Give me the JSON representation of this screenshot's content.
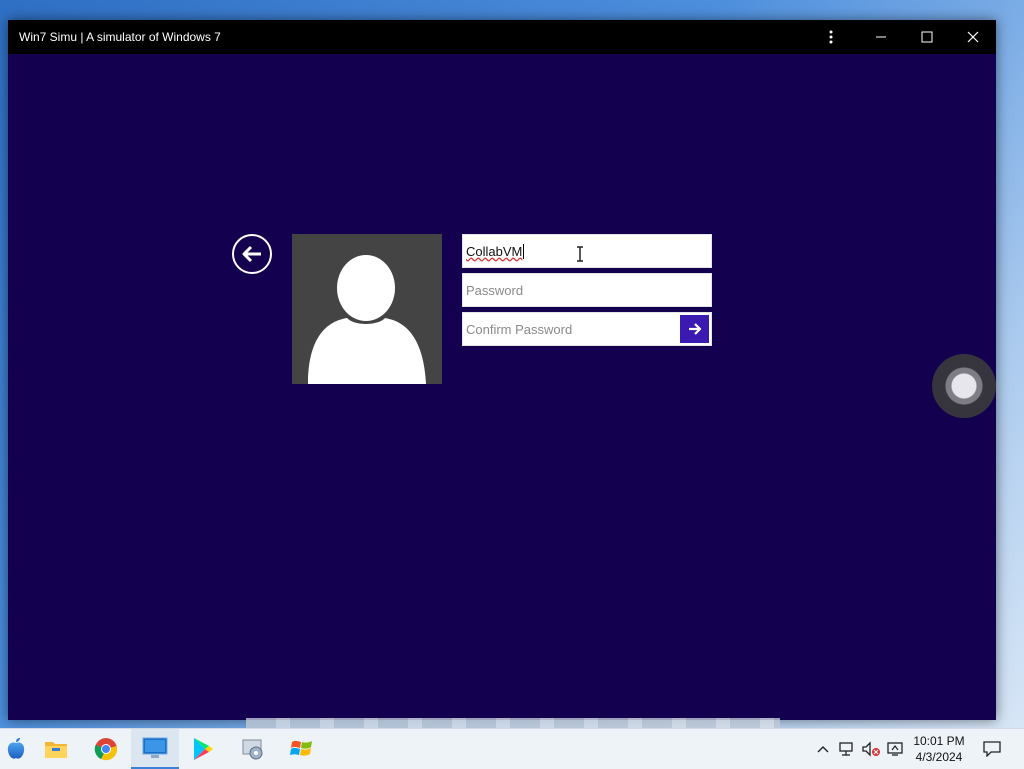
{
  "window": {
    "title": "Win7 Simu | A simulator of Windows 7"
  },
  "login": {
    "username_value": "CollabVM",
    "password_placeholder": "Password",
    "confirm_placeholder": "Confirm Password"
  },
  "taskbar": {
    "apps": [
      "apple-icon",
      "file-explorer-icon",
      "chrome-icon",
      "win7-simu-icon",
      "play-store-icon",
      "media-icon",
      "windows-logo-icon"
    ],
    "active_app": "win7-simu-icon",
    "tray_icons": [
      "chevron-up-icon",
      "network-icon",
      "volume-muted-icon",
      "remote-icon",
      "notification-icon"
    ]
  },
  "clock": {
    "time": "10:01 PM",
    "date": "4/3/2024"
  },
  "colors": {
    "window_bg": "#13004f",
    "titlebar_bg": "#000000",
    "accent": "#3a1ab0",
    "avatar_bg": "#444444"
  }
}
